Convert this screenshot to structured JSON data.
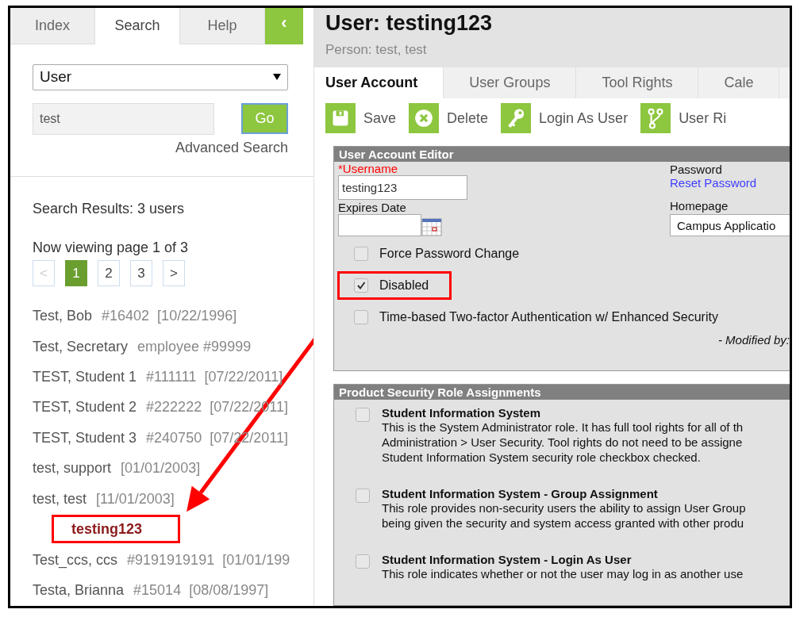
{
  "sidebar": {
    "tabs": [
      {
        "label": "Index",
        "selected": false
      },
      {
        "label": "Search",
        "selected": true
      },
      {
        "label": "Help",
        "selected": false
      }
    ],
    "collapse_button": {
      "label": "‹"
    },
    "search_type": {
      "value": "User"
    },
    "search_field": {
      "value": "test"
    },
    "go_button": {
      "label": "Go"
    },
    "advanced_search": "Advanced Search",
    "results_summary": "Search Results: 3 users",
    "page_info": "Now viewing page 1 of 3",
    "pagination": [
      {
        "label": "<",
        "selected": false,
        "disabled": true
      },
      {
        "label": "1",
        "selected": true,
        "disabled": false
      },
      {
        "label": "2",
        "selected": false,
        "disabled": false
      },
      {
        "label": "3",
        "selected": false,
        "disabled": false
      },
      {
        "label": ">",
        "selected": false,
        "disabled": false
      }
    ],
    "results": [
      {
        "name": "Test, Bob",
        "detail": "#16402  [10/22/1996]"
      },
      {
        "name": "Test, Secretary",
        "detail": "employee #99999"
      },
      {
        "name": "TEST, Student 1",
        "detail": "#111111  [07/22/2011]"
      },
      {
        "name": "TEST, Student 2",
        "detail": "#222222  [07/22/2011]"
      },
      {
        "name": "TEST, Student 3",
        "detail": "#240750  [07/22/2011]"
      },
      {
        "name": "test, support",
        "detail": "[01/01/2003]"
      },
      {
        "name": "test, test",
        "detail": "[11/01/2003]",
        "children": [
          {
            "name": "testing123",
            "highlighted": true
          }
        ]
      },
      {
        "name": "Test_ccs, ccs",
        "detail": "#9191919191  [01/01/199"
      },
      {
        "name": "Testa, Brianna",
        "detail": "#15014  [08/08/1997]"
      }
    ]
  },
  "header": {
    "title": "User: testing123",
    "subtitle": "Person: test, test"
  },
  "tabs": [
    {
      "label": "User Account",
      "selected": true
    },
    {
      "label": "User Groups",
      "selected": false
    },
    {
      "label": "Tool Rights",
      "selected": false
    },
    {
      "label": "Cale",
      "selected": false
    }
  ],
  "toolbar": [
    {
      "kind": "save",
      "label": "Save"
    },
    {
      "kind": "delete",
      "label": "Delete"
    },
    {
      "kind": "key",
      "label": "Login As User"
    },
    {
      "kind": "branch",
      "label": "User Ri"
    }
  ],
  "editor": {
    "title": "User Account Editor",
    "username": {
      "label": "*Username",
      "value": "testing123"
    },
    "expires": {
      "label": "Expires Date"
    },
    "password": {
      "label": "Password",
      "link": "Reset Password"
    },
    "homepage": {
      "label": "Homepage",
      "value": "Campus Applicatio"
    },
    "options": [
      {
        "label": "Force Password Change",
        "checked": false,
        "highlighted": false
      },
      {
        "label": "Disabled",
        "checked": true,
        "highlighted": true
      },
      {
        "label": "Time-based Two-factor Authentication w/ Enhanced Security",
        "checked": false,
        "highlighted": false
      }
    ],
    "modified": "- Modified by: "
  },
  "roles": {
    "title": "Product Security Role Assignments",
    "items": [
      {
        "name": "Student Information System",
        "checked": false,
        "description_lines": [
          "This is the System Administrator role. It has full tool rights for all of th",
          "Administration > User Security. Tool rights do not need to be assigne",
          "Student Information System security role checkbox checked."
        ]
      },
      {
        "name": "Student Information System - Group Assignment",
        "checked": false,
        "description_lines": [
          "This role provides non-security users the ability to assign User Group",
          "being given the security and system access granted with other produ"
        ]
      },
      {
        "name": "Student Information System - Login As User",
        "checked": false,
        "description_lines": [
          "This role indicates whether or not the user may log in as another use"
        ]
      }
    ]
  }
}
